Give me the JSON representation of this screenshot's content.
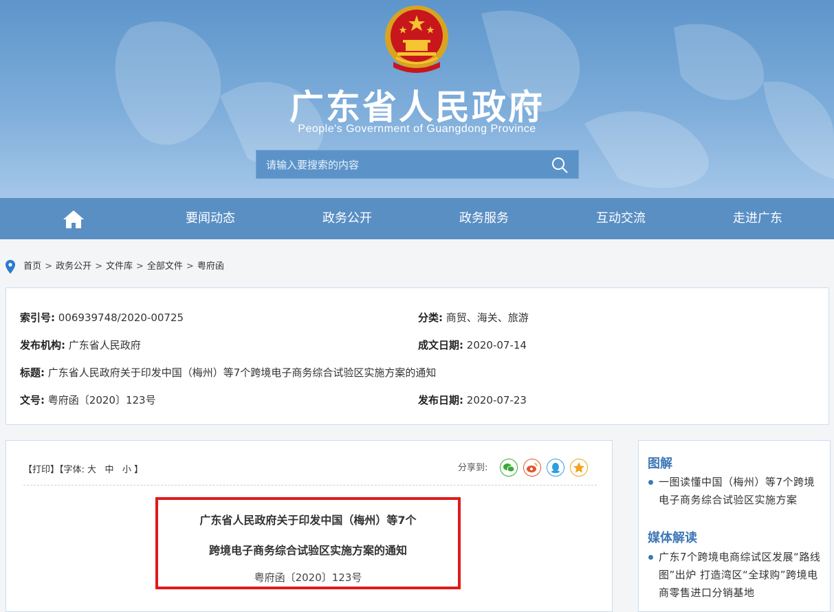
{
  "header": {
    "title": "广东省人民政府",
    "subtitle": "People's Government of Guangdong Province",
    "search_placeholder": "请输入要搜索的内容"
  },
  "nav": {
    "home_icon": "home-icon",
    "items": [
      "要闻动态",
      "政务公开",
      "政务服务",
      "互动交流",
      "走进广东"
    ]
  },
  "breadcrumb": [
    "首页",
    "政务公开",
    "文件库",
    "全部文件",
    "粤府函"
  ],
  "meta": {
    "index_label": "索引号:",
    "index_value": "006939748/2020-00725",
    "category_label": "分类:",
    "category_value": "商贸、海关、旅游",
    "issuer_label": "发布机构:",
    "issuer_value": "广东省人民政府",
    "created_label": "成文日期:",
    "created_value": "2020-07-14",
    "title_label": "标题:",
    "title_value": "广东省人民政府关于印发中国（梅州）等7个跨境电子商务综合试验区实施方案的通知",
    "doc_label": "文号:",
    "doc_value": "粤府函〔2020〕123号",
    "published_label": "发布日期:",
    "published_value": "2020-07-23"
  },
  "tools": {
    "print": "【打印】",
    "font_prefix": "【字体:",
    "font_large": "大",
    "font_medium": "中",
    "font_small": "小",
    "font_suffix": "】",
    "share_label": "分享到:"
  },
  "article": {
    "title_line1": "广东省人民政府关于印发中国（梅州）等7个",
    "title_line2": "跨境电子商务综合试验区实施方案的通知",
    "doc_number": "粤府函〔2020〕123号"
  },
  "sidebar": {
    "section1_title": "图解",
    "section1_items": [
      "一图读懂中国（梅州）等7个跨境电子商务综合试验区实施方案"
    ],
    "section2_title": "媒体解读",
    "section2_items": [
      "广东7个跨境电商综试区发展“路线图”出炉 打造湾区“全球购”跨境电商零售进口分销基地"
    ]
  },
  "colors": {
    "nav_bg": "#5a8fc4",
    "accent": "#3d78b6",
    "highlight_border": "#e01a1a"
  }
}
